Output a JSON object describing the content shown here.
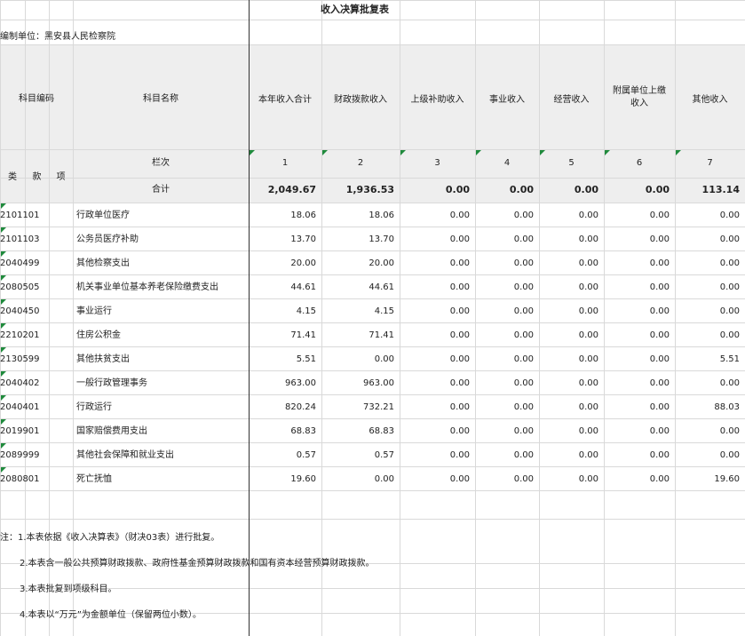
{
  "title": "收入决算批复表",
  "unit_label": "编制单位：黑安县人民检察院",
  "headers": {
    "code": "科目编码",
    "name": "科目名称",
    "cols": [
      "本年收入合计",
      "财政拨款收入",
      "上级补助收入",
      "事业收入",
      "经营收入",
      "附属单位上缴收入",
      "其他收入"
    ],
    "class": "类",
    "section": "款",
    "item": "项",
    "row_index_label": "栏次",
    "col_numbers": [
      "1",
      "2",
      "3",
      "4",
      "5",
      "6",
      "7"
    ],
    "total_label": "合计",
    "totals": [
      "2,049.67",
      "1,936.53",
      "0.00",
      "0.00",
      "0.00",
      "0.00",
      "113.14"
    ]
  },
  "rows": [
    {
      "code": "2101101",
      "name": "行政单位医疗",
      "values": [
        "18.06",
        "18.06",
        "0.00",
        "0.00",
        "0.00",
        "0.00",
        "0.00"
      ]
    },
    {
      "code": "2101103",
      "name": "公务员医疗补助",
      "values": [
        "13.70",
        "13.70",
        "0.00",
        "0.00",
        "0.00",
        "0.00",
        "0.00"
      ]
    },
    {
      "code": "2040499",
      "name": "其他检察支出",
      "values": [
        "20.00",
        "20.00",
        "0.00",
        "0.00",
        "0.00",
        "0.00",
        "0.00"
      ]
    },
    {
      "code": "2080505",
      "name": "机关事业单位基本养老保险缴费支出",
      "values": [
        "44.61",
        "44.61",
        "0.00",
        "0.00",
        "0.00",
        "0.00",
        "0.00"
      ]
    },
    {
      "code": "2040450",
      "name": "事业运行",
      "values": [
        "4.15",
        "4.15",
        "0.00",
        "0.00",
        "0.00",
        "0.00",
        "0.00"
      ]
    },
    {
      "code": "2210201",
      "name": "住房公积金",
      "values": [
        "71.41",
        "71.41",
        "0.00",
        "0.00",
        "0.00",
        "0.00",
        "0.00"
      ]
    },
    {
      "code": "2130599",
      "name": "其他扶贫支出",
      "values": [
        "5.51",
        "0.00",
        "0.00",
        "0.00",
        "0.00",
        "0.00",
        "5.51"
      ]
    },
    {
      "code": "2040402",
      "name": "一般行政管理事务",
      "values": [
        "963.00",
        "963.00",
        "0.00",
        "0.00",
        "0.00",
        "0.00",
        "0.00"
      ]
    },
    {
      "code": "2040401",
      "name": "行政运行",
      "values": [
        "820.24",
        "732.21",
        "0.00",
        "0.00",
        "0.00",
        "0.00",
        "88.03"
      ]
    },
    {
      "code": "2019901",
      "name": "国家赔偿费用支出",
      "values": [
        "68.83",
        "68.83",
        "0.00",
        "0.00",
        "0.00",
        "0.00",
        "0.00"
      ]
    },
    {
      "code": "2089999",
      "name": "其他社会保障和就业支出",
      "values": [
        "0.57",
        "0.57",
        "0.00",
        "0.00",
        "0.00",
        "0.00",
        "0.00"
      ]
    },
    {
      "code": "2080801",
      "name": "死亡抚恤",
      "values": [
        "19.60",
        "0.00",
        "0.00",
        "0.00",
        "0.00",
        "0.00",
        "19.60"
      ]
    }
  ],
  "notes": [
    "注：1.本表依据《收入决算表》（财决03表）进行批复。",
    "2.本表含一般公共预算财政拨款、政府性基金预算财政拨款和国有资本经营预算财政拨款。",
    "3.本表批复到项级科目。",
    "4.本表以“万元”为金额单位（保留两位小数）。"
  ]
}
